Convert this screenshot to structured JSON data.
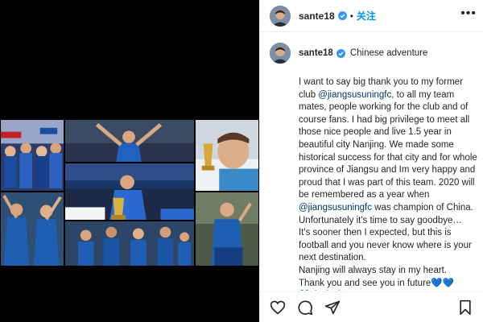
{
  "post": {
    "username": "sante18",
    "follow_label": "关注",
    "separator": "•",
    "more_label": "•••",
    "caption_title": "Chinese adventure",
    "caption": {
      "p1_a": "I want to say big thank you to my former club ",
      "mention_1": "@jiangsusuningfc",
      "p1_b": ", to all my team mates, people working for the club and of course fans. I had big privilege to meet all those nice people and live 1.5 year in beautiful city Nanjing. We made some historical success for that city and for whole province of Jiangsu and Im very happy and proud that I was part of this team. 2020 will be remembered as a year when ",
      "mention_2": "@jiangsusuningfc",
      "p1_c": " was champion of China. Unfortunately it's time to say goodbye…",
      "p2": "It's sooner then I expected, but this is football and you never know where is your next destination.",
      "p3": "Nanjing will always stay in my heart.",
      "p4": "Thank you and see you in future",
      "hearts": "💙💙",
      "hands": "🙏🙏🙏"
    }
  },
  "colors": {
    "accent": "#0095f6",
    "mention": "#00376b",
    "team_blue": "#1e5fb4",
    "media_bg": "#000000"
  },
  "icons": {
    "like": "heart-icon",
    "comment": "comment-icon",
    "share": "share-icon",
    "save": "bookmark-icon",
    "verified": "verified-badge-icon",
    "more": "more-options-icon"
  }
}
